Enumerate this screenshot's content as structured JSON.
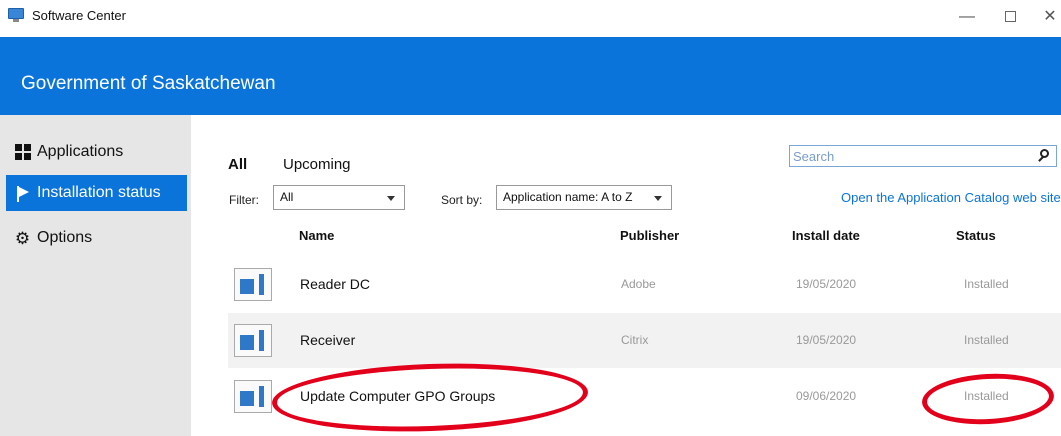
{
  "window": {
    "title": "Software Center",
    "minimize_glyph": "—",
    "close_glyph": "✕"
  },
  "header": {
    "org_name": "Government of Saskatchewan"
  },
  "sidebar": {
    "items": [
      {
        "label": "Applications",
        "icon": "applications-grid-icon",
        "selected": false
      },
      {
        "label": "Installation status",
        "icon": "flag-icon",
        "selected": true
      },
      {
        "label": "Options",
        "icon": "gear-icon",
        "selected": false
      }
    ]
  },
  "main": {
    "tabs": [
      {
        "label": "All",
        "active": true
      },
      {
        "label": "Upcoming",
        "active": false
      }
    ],
    "search": {
      "placeholder": "Search",
      "value": ""
    },
    "catalog_link": "Open the Application Catalog web site",
    "filter": {
      "label": "Filter:",
      "value": "All"
    },
    "sort": {
      "label": "Sort by:",
      "value": "Application name: A to Z"
    },
    "columns": [
      "Name",
      "Publisher",
      "Install date",
      "Status"
    ],
    "rows": [
      {
        "name": "Reader DC",
        "publisher": "Adobe",
        "install_date": "19/05/2020",
        "status": "Installed"
      },
      {
        "name": "Receiver",
        "publisher": "Citrix",
        "install_date": "19/05/2020",
        "status": "Installed"
      },
      {
        "name": "Update Computer GPO Groups",
        "publisher": "",
        "install_date": "09/06/2020",
        "status": "Installed"
      }
    ]
  },
  "colors": {
    "accent": "#0a74da",
    "sidebar_bg": "#e6e6e6",
    "annotation": "#e3001b"
  }
}
